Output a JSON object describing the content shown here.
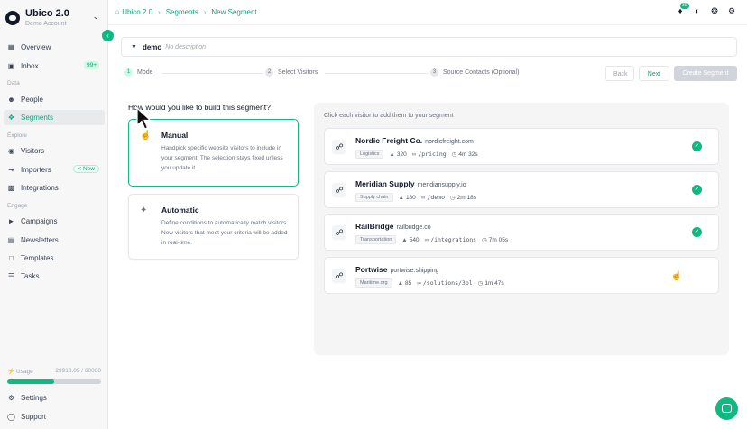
{
  "app": {
    "title": "Ubico 2.0",
    "subtitle": "Demo Account"
  },
  "sidebar": {
    "items": [
      {
        "label": "Overview",
        "icon": "grid-icon"
      },
      {
        "label": "Inbox",
        "icon": "inbox-icon",
        "badge": "99+"
      },
      {
        "label": "People",
        "icon": "people-icon"
      },
      {
        "label": "Segments",
        "icon": "segments-icon",
        "active": true
      },
      {
        "label": "Visitors",
        "icon": "eye-icon"
      },
      {
        "label": "Importers",
        "icon": "import-icon",
        "badge": "New"
      },
      {
        "label": "Integrations",
        "icon": "puzzle-icon"
      },
      {
        "label": "Campaigns",
        "icon": "megaphone-icon"
      },
      {
        "label": "Newsletters",
        "icon": "newsletter-icon"
      },
      {
        "label": "Templates",
        "icon": "template-icon"
      },
      {
        "label": "Tasks",
        "icon": "tasks-icon"
      },
      {
        "label": "Settings",
        "icon": "gear-icon"
      },
      {
        "label": "Support",
        "icon": "support-icon"
      }
    ],
    "sections": {
      "data": "Data",
      "explore": "Explore",
      "engage": "Engage"
    },
    "usage": {
      "label": "Usage",
      "value": "29918.05 / 60000",
      "fraction": 0.5
    }
  },
  "breadcrumb": [
    "Ubico 2.0",
    "Segments",
    "New Segment"
  ],
  "notifications": {
    "count": "39"
  },
  "segment": {
    "name": "demo",
    "description_placeholder": "No description"
  },
  "stepper": {
    "steps": [
      {
        "num": "1",
        "label": "Mode"
      },
      {
        "num": "2",
        "label": "Select Visitors"
      },
      {
        "num": "3",
        "label": "Source Contacts (Optional)"
      }
    ],
    "back_label": "Back",
    "next_label": "Next",
    "create_label": "Create Segment"
  },
  "build": {
    "question": "How would you like to build this segment?",
    "manual": {
      "title": "Manual",
      "description": "Handpick specific website visitors to include in your segment. The selection stays fixed unless you update it."
    },
    "automatic": {
      "title": "Automatic",
      "description": "Define conditions to automatically match visitors. New visitors that meet your criteria will be added in real-time."
    }
  },
  "visitors": {
    "instruction": "Click each visitor to add them to your segment",
    "list": [
      {
        "name": "Nordic Freight Co.",
        "domain": "nordicfreight.com",
        "tag": "Logistics",
        "views": "320",
        "path": "/pricing",
        "time": "4m 32s",
        "selected": true
      },
      {
        "name": "Meridian Supply",
        "domain": "meridiansupply.io",
        "tag": "Supply chain",
        "views": "180",
        "path": "/demo",
        "time": "2m 18s",
        "selected": true
      },
      {
        "name": "RailBridge",
        "domain": "railbridge.co",
        "tag": "Transportation",
        "views": "540",
        "path": "/integrations",
        "time": "7m 05s",
        "selected": true
      },
      {
        "name": "Portwise",
        "domain": "portwise.shipping",
        "tag": "Maritime.org",
        "views": "85",
        "path": "/solutions/3pl",
        "time": "1m 47s",
        "selected": false
      }
    ]
  },
  "colors": {
    "accent": "#10b981",
    "accent_text": "#10a37f"
  }
}
